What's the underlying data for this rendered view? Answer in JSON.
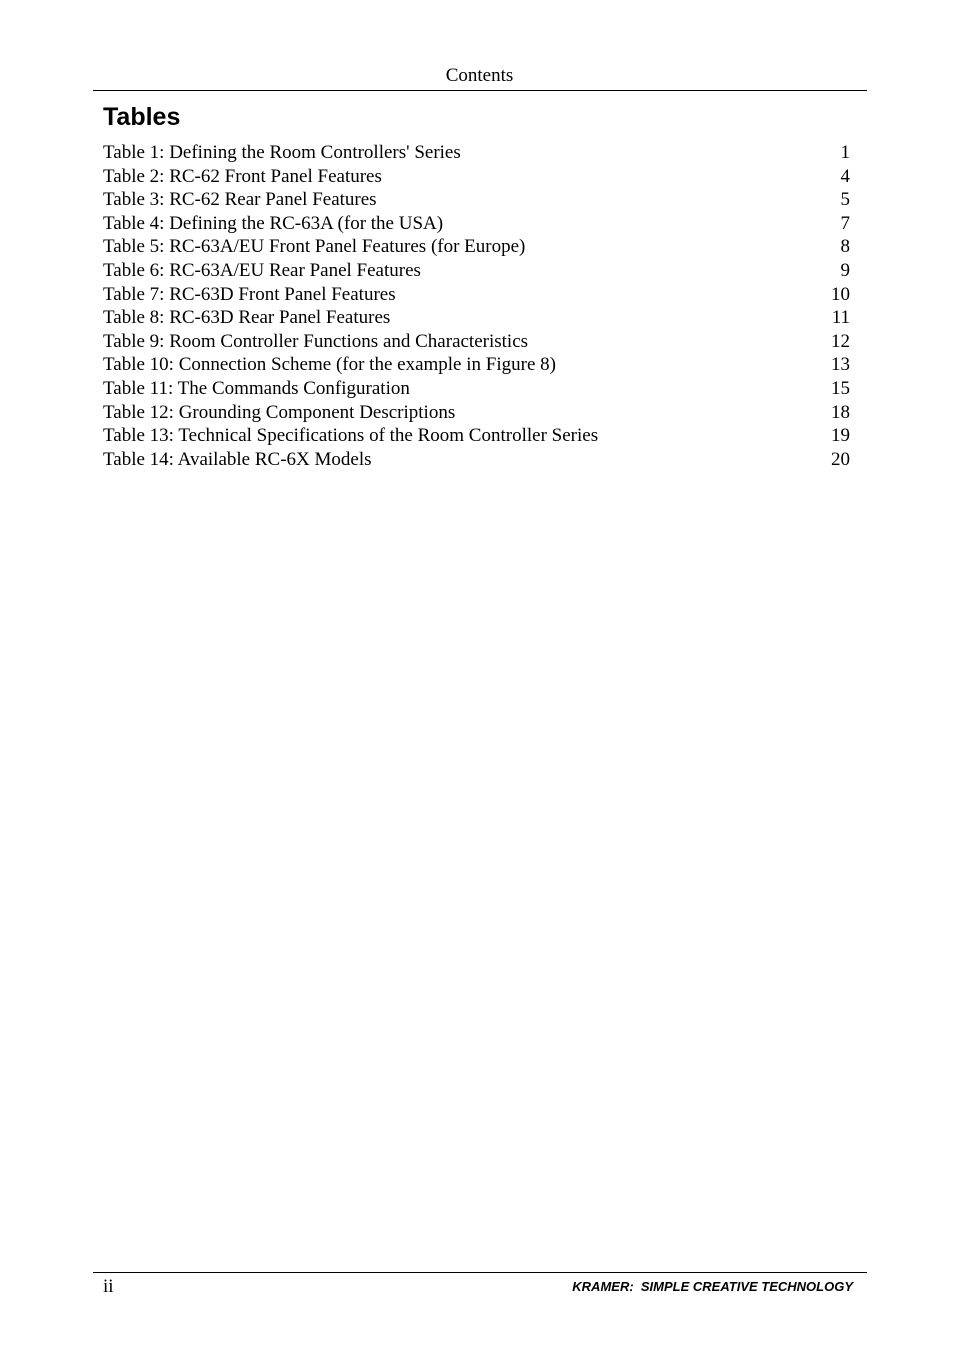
{
  "header": {
    "title": "Contents"
  },
  "section": {
    "title": "Tables"
  },
  "toc": {
    "entries": [
      {
        "label": "Table 1: Defining the Room Controllers' Series",
        "page": "1"
      },
      {
        "label": "Table 2: RC-62 Front Panel Features",
        "page": "4"
      },
      {
        "label": "Table 3: RC-62 Rear Panel Features",
        "page": "5"
      },
      {
        "label": "Table 4: Defining the RC-63A (for the USA)",
        "page": "7"
      },
      {
        "label": "Table 5: RC-63A/EU Front Panel Features (for Europe)",
        "page": "8"
      },
      {
        "label": "Table 6: RC-63A/EU Rear Panel Features",
        "page": "9"
      },
      {
        "label": "Table 7: RC-63D Front Panel Features",
        "page": "10"
      },
      {
        "label": "Table 8: RC-63D Rear Panel Features",
        "page": "11"
      },
      {
        "label": "Table 9: Room Controller Functions and Characteristics",
        "page": "12"
      },
      {
        "label": "Table 10: Connection Scheme (for the example in Figure 8)",
        "page": "13"
      },
      {
        "label": "Table 11: The Commands Configuration",
        "page": "15"
      },
      {
        "label": "Table 12: Grounding Component Descriptions",
        "page": "18"
      },
      {
        "label": "Table 13: Technical Specifications of the Room Controller Series",
        "page": "19"
      },
      {
        "label": "Table 14: Available RC-6X Models",
        "page": "20"
      }
    ]
  },
  "footer": {
    "page_number": "ii",
    "brand": "KRAMER:  SIMPLE CREATIVE TECHNOLOGY"
  }
}
